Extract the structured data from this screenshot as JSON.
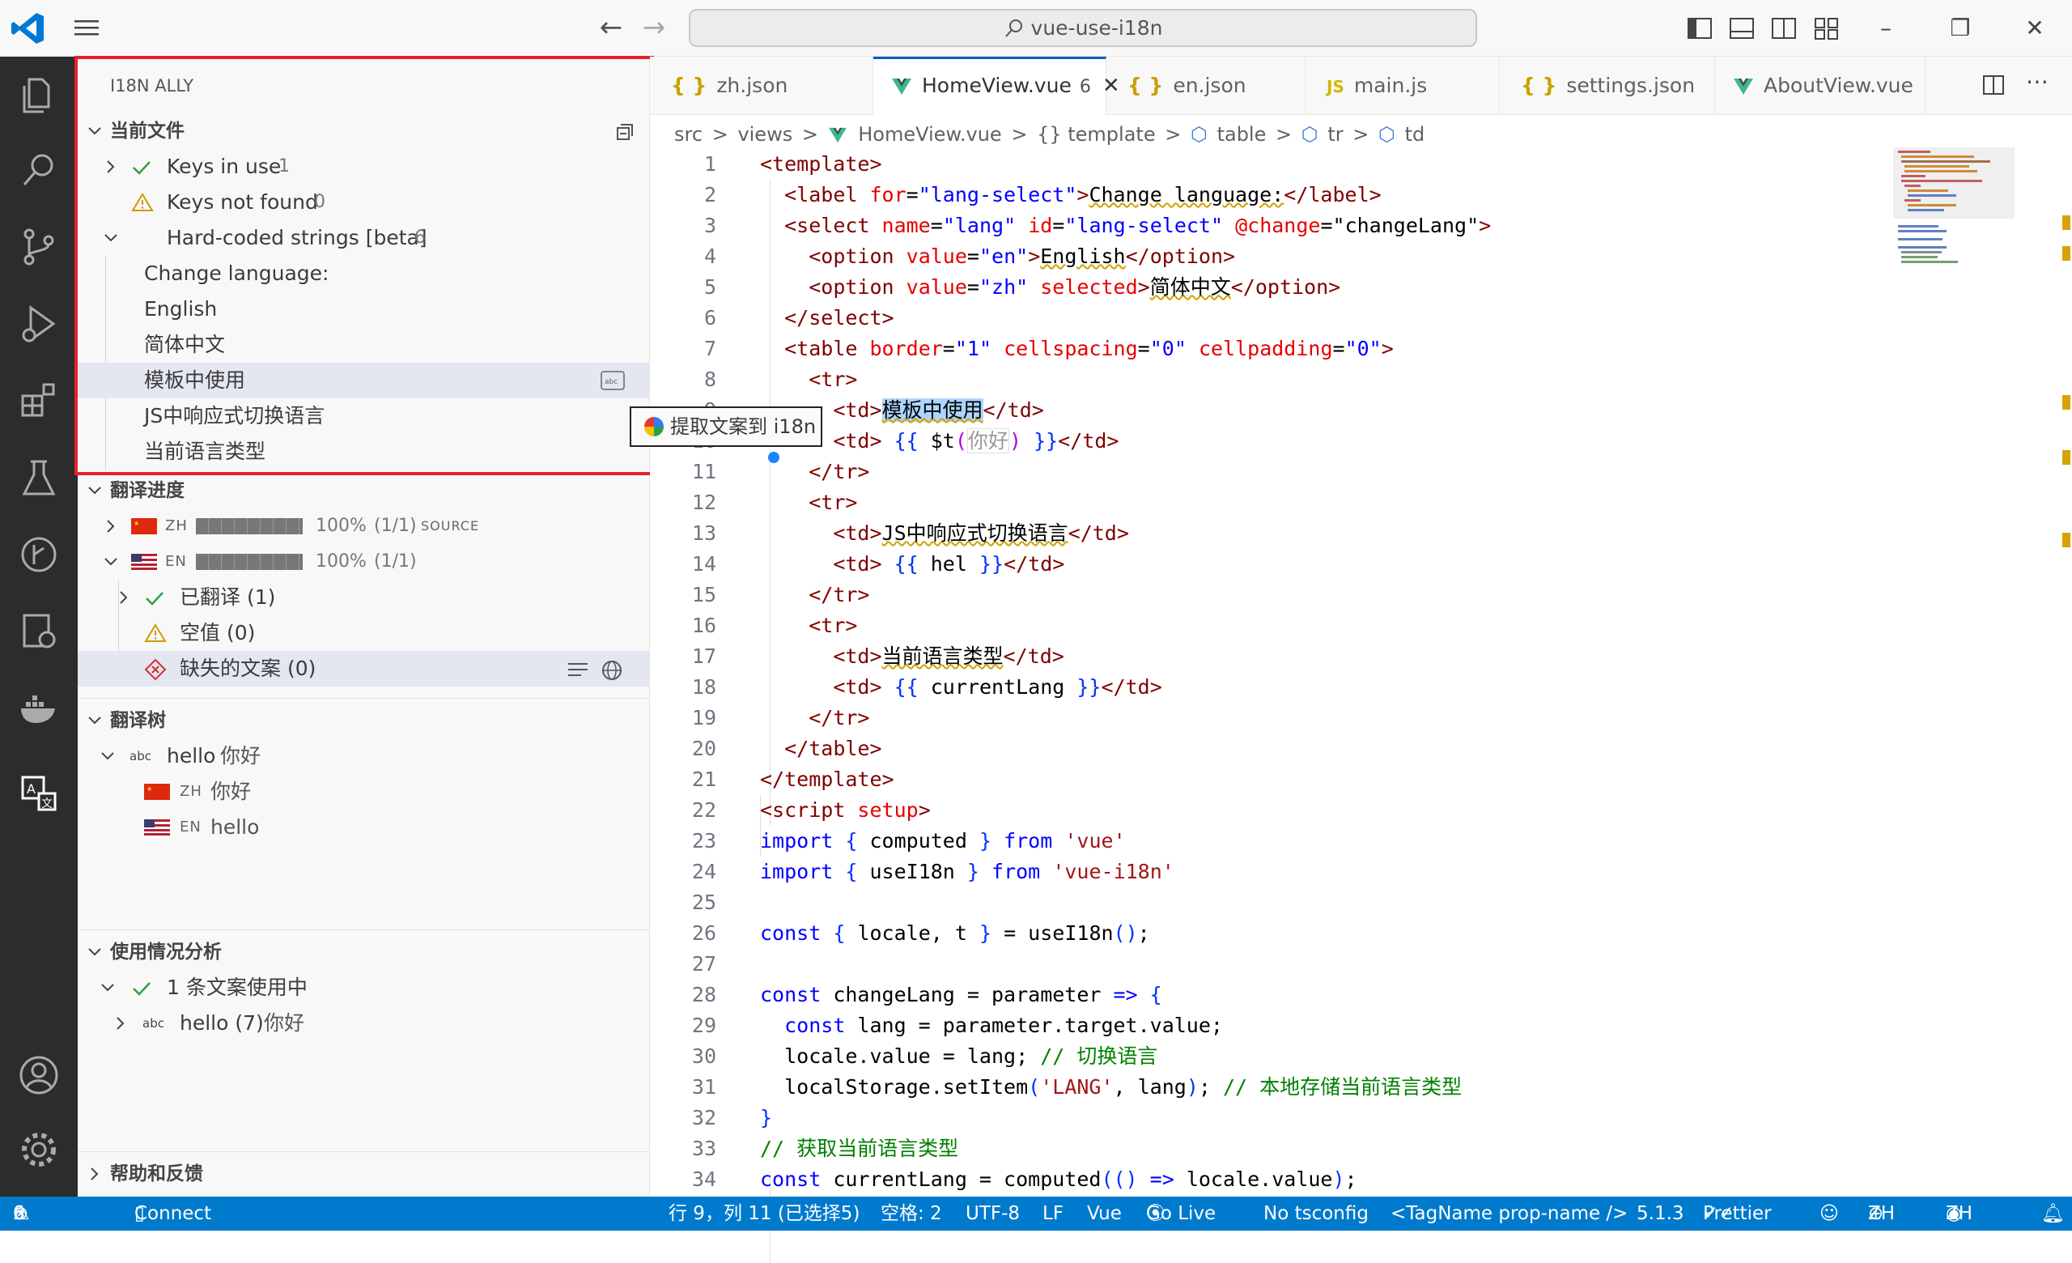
{
  "titlebar": {
    "search_text": "vue-use-i18n"
  },
  "sidebar": {
    "title": "I18N ALLY",
    "current_file": {
      "header": "当前文件",
      "keys_in_use": "Keys in use",
      "keys_in_use_count": "1",
      "keys_not_found": "Keys not found",
      "keys_not_found_count": "0",
      "hardcoded": "Hard-coded strings [beta]",
      "hardcoded_count": "6",
      "strings": [
        "Change language:",
        "English",
        "简体中文",
        "模板中使用",
        "JS中响应式切换语言",
        "当前语言类型"
      ],
      "tooltip": "提取文案到 i18n"
    },
    "progress": {
      "header": "翻译进度",
      "langs": [
        {
          "code": "ZH",
          "percent": "100%",
          "ratio": "(1/1)",
          "tag": "SOURCE",
          "fill": 1.0
        },
        {
          "code": "EN",
          "percent": "100%",
          "ratio": "(1/1)",
          "tag": "",
          "fill": 1.0
        }
      ],
      "translated": "已翻译 (1)",
      "empty": "空值 (0)",
      "missing": "缺失的文案 (0)"
    },
    "tree": {
      "header": "翻译树",
      "key": "hello",
      "key_value": "你好",
      "zh_code": "ZH",
      "zh_value": "你好",
      "en_code": "EN",
      "en_value": "hello"
    },
    "usage": {
      "header": "使用情况分析",
      "in_use": "1 条文案使用中",
      "item": "hello (7)",
      "item_value": "你好"
    },
    "help": {
      "header": "帮助和反馈"
    }
  },
  "tabs": [
    {
      "icon": "{ }",
      "label": "zh.json",
      "active": false
    },
    {
      "icon": "V",
      "label": "HomeView.vue",
      "badge": "6",
      "active": true
    },
    {
      "icon": "{ }",
      "label": "en.json",
      "active": false
    },
    {
      "icon": "JS",
      "label": "main.js",
      "active": false
    },
    {
      "icon": "{ }",
      "label": "settings.json",
      "active": false
    },
    {
      "icon": "V",
      "label": "AboutView.vue",
      "active": false
    }
  ],
  "breadcrumb": [
    "src",
    ">",
    "views",
    ">",
    "HomeView.vue",
    ">",
    "{} template",
    ">",
    "table",
    ">",
    "tr",
    ">",
    "td"
  ],
  "line_numbers": [
    "1",
    "2",
    "3",
    "4",
    "5",
    "6",
    "7",
    "8",
    "9",
    "10",
    "11",
    "12",
    "13",
    "14",
    "15",
    "16",
    "17",
    "18",
    "19",
    "20",
    "21",
    "22",
    "23",
    "24",
    "25",
    "26",
    "27",
    "28",
    "29",
    "30",
    "31",
    "32",
    "33",
    "34"
  ],
  "status": {
    "errors": "0",
    "warnings": "6",
    "connect": "Connect",
    "position": "行 9，列 11 (已选择5)",
    "spaces": "空格: 2",
    "encoding": "UTF-8",
    "eol": "LF",
    "language": "Vue",
    "golive": "Go Live",
    "tsconfig": "No tsconfig",
    "tagname": "<TagName prop-name />",
    "version": "5.1.3",
    "prettier": "Prettier",
    "locale1": "ZH",
    "locale2": "ZH"
  },
  "colors": {
    "accent": "#007acc",
    "highlight": "#e8212d"
  }
}
